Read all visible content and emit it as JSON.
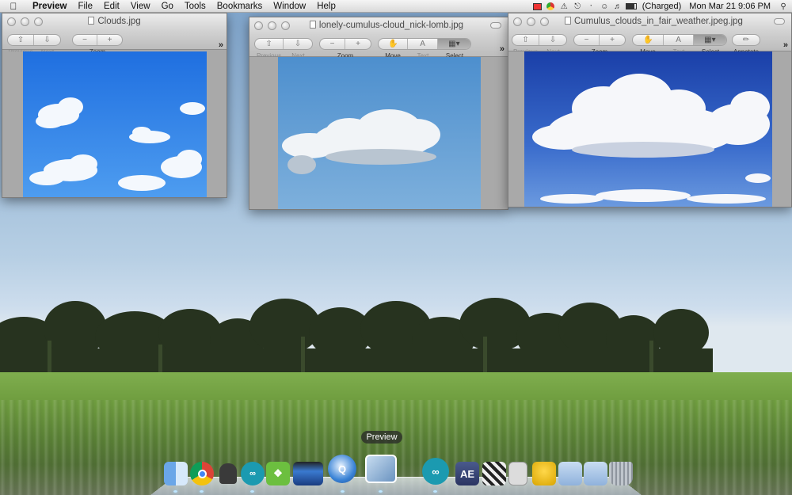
{
  "menubar": {
    "apple": "",
    "items": [
      "Preview",
      "File",
      "Edit",
      "View",
      "Go",
      "Tools",
      "Bookmarks",
      "Window",
      "Help"
    ],
    "battery_status": "(Charged)",
    "clock": "Mon Mar 21  9:06 PM"
  },
  "windows": [
    {
      "title": "Clouds.jpg",
      "toolbar": {
        "previous": "Previous",
        "next": "Next",
        "zoom": "Zoom"
      },
      "overflow": "»"
    },
    {
      "title": "lonely-cumulus-cloud_nick-lomb.jpg",
      "toolbar": {
        "previous": "Previous",
        "next": "Next",
        "zoom": "Zoom",
        "move": "Move",
        "text": "Text",
        "select": "Select"
      },
      "overflow": "»"
    },
    {
      "title": "Cumulus_clouds_in_fair_weather.jpeg.jpg",
      "toolbar": {
        "previous": "Previous",
        "next": "Next",
        "zoom": "Zoom",
        "move": "Move",
        "text": "Text",
        "select": "Select",
        "annotate": "Annotate"
      },
      "overflow": "»"
    }
  ],
  "dock": {
    "tooltip": "Preview",
    "items": [
      "finder-icon",
      "chrome-icon",
      "spy-icon",
      "arduino-icon",
      "evernote-icon",
      "imovie-icon",
      "quicktime-icon",
      "preview-icon",
      "arduino-icon",
      "after-effects-icon",
      "clapper-icon",
      "calculator-icon",
      "cyberduck-icon",
      "applications-folder-icon",
      "downloads-folder-icon",
      "trash-icon"
    ],
    "after_effects_label": "AE"
  },
  "colors": {
    "sky_blue": "#3b86e6",
    "menubar_bg": "#e8e8e8"
  }
}
